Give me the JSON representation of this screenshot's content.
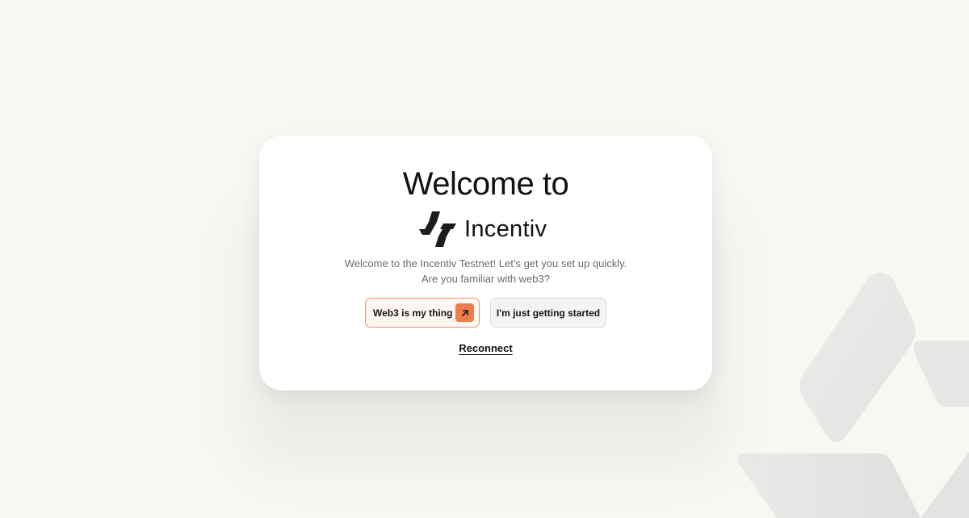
{
  "welcome": {
    "title": "Welcome to",
    "brand_name": "Incentiv",
    "subtitle_line1": "Welcome to the Incentiv Testnet! Let’s get you set up quickly.",
    "subtitle_line2": "Are you familiar with web3?"
  },
  "actions": {
    "web3_button_label": "Web3 is my thing",
    "web3_button_icon": "arrow-up-right-icon",
    "beginner_button_label": "I'm just getting started",
    "reconnect_label": "Reconnect"
  },
  "colors": {
    "background": "#f7f7f3",
    "accent": "#ec7d4c",
    "primary_button_border": "#e8946a",
    "primary_button_bg": "#fff6f1"
  },
  "icons": {
    "logo": "incentiv-logo-icon",
    "background_decoration": "incentiv-mark-decoration"
  }
}
